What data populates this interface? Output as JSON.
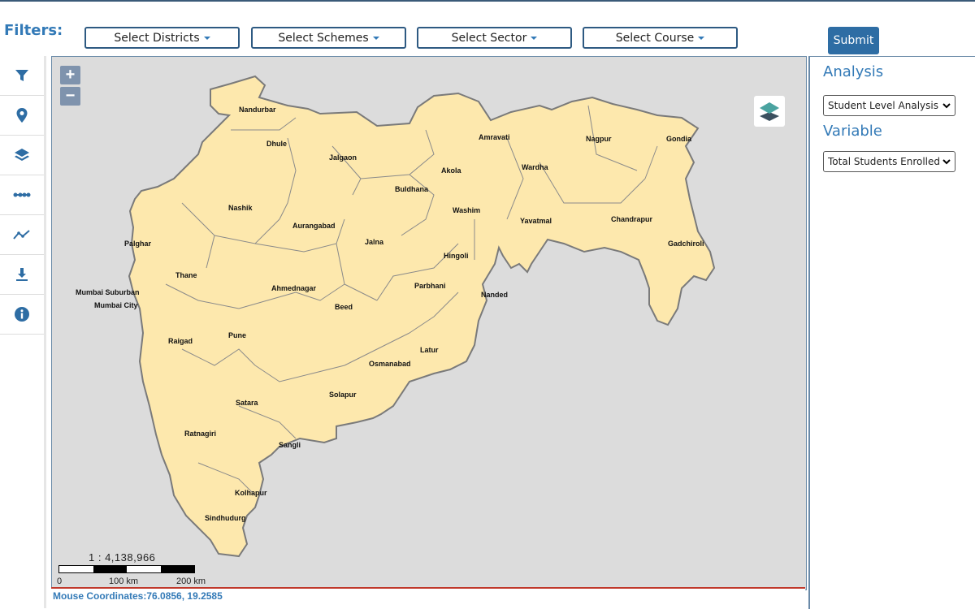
{
  "filters": {
    "label": "Filters:",
    "districts": "Select Districts",
    "schemes": "Select Schemes",
    "sector": "Select Sector",
    "course": "Select Course",
    "submit": "Submit"
  },
  "toolbar": {
    "tools": [
      "filter-icon",
      "location-pin-icon",
      "layers-icon",
      "measure-line-icon",
      "chart-line-icon",
      "download-icon",
      "info-icon"
    ]
  },
  "map": {
    "zoom_in": "+",
    "zoom_out": "−",
    "scale_ratio": "1 : 4,138,966",
    "scale_labels": [
      "0",
      "100 km",
      "200 km"
    ],
    "coordinates_label": "Mouse Coordinates:",
    "coordinates_value": "76.0856, 19.2585",
    "districts": [
      "Nandurbar",
      "Dhule",
      "Jalgaon",
      "Amravati",
      "Nagpur",
      "Gondia",
      "Akola",
      "Wardha",
      "Buldhana",
      "Nashik",
      "Washim",
      "Yavatmal",
      "Chandrapur",
      "Aurangabad",
      "Palghar",
      "Jalna",
      "Gadchiroli",
      "Hingoli",
      "Thane",
      "Ahmednagar",
      "Parbhani",
      "Mumbai Suburban",
      "Nanded",
      "Mumbai City",
      "Beed",
      "Raigad",
      "Pune",
      "Latur",
      "Osmanabad",
      "Solapur",
      "Satara",
      "Ratnagiri",
      "Sangli",
      "Kolhapur",
      "Sindhudurg"
    ],
    "colors": {
      "land": "#fde8ad",
      "border": "#7a7a7a",
      "background": "#dcdcdc"
    }
  },
  "panel": {
    "analysis_heading": "Analysis",
    "analysis_value": "Student Level Analysis",
    "variable_heading": "Variable",
    "variable_value": "Total Students Enrolled"
  }
}
